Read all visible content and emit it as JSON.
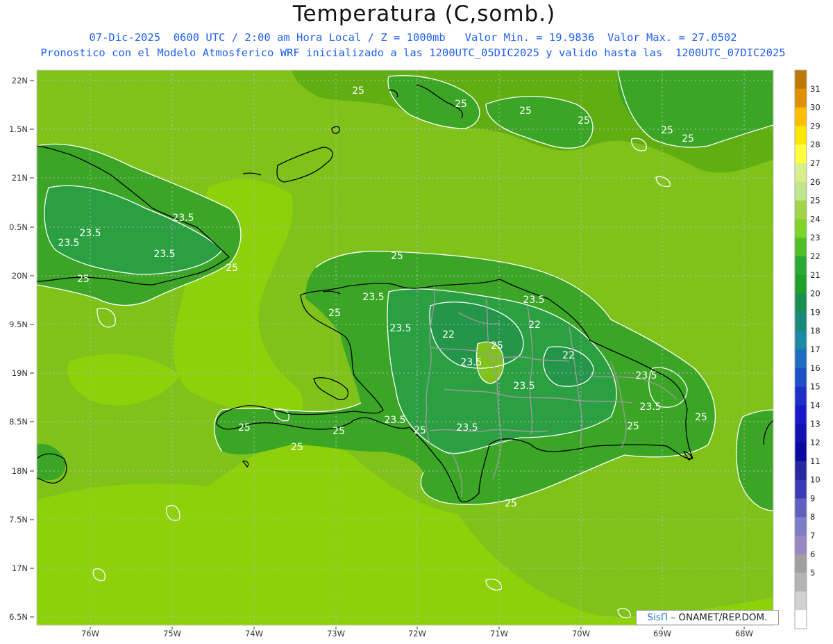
{
  "header": {
    "title": "Temperatura (C,somb.)",
    "line1": "07-Dic-2025  0600 UTC / 2:00 am Hora Local / Z = 1000mb   Valor Min. = 19.9836  Valor Max. = 27.0502",
    "line2": "Pronostico con el Modelo Atmosferico WRF inicializado a las 1200UTC_05DIC2025 y valido hasta las  1200UTC_07DIC2025"
  },
  "credit": {
    "brand": "SisΠ",
    "org": " – ONAMET/REP.DOM."
  },
  "axes": {
    "lat_labels": [
      "22N",
      "1.5N",
      "21N",
      "0.5N",
      "20N",
      "9.5N",
      "19N",
      "8.5N",
      "18N",
      "7.5N",
      "17N",
      "6.5N"
    ],
    "lon_labels": [
      "76W",
      "75W",
      "74W",
      "73W",
      "72W",
      "71W",
      "70W",
      "69W",
      "68W"
    ]
  },
  "colorbar": {
    "labels": [
      "31",
      "30",
      "29",
      "28",
      "27",
      "26",
      "25",
      "24",
      "23",
      "22",
      "21",
      "20",
      "19",
      "18",
      "17",
      "16",
      "15",
      "14",
      "13",
      "12",
      "11",
      "10",
      "9",
      "8",
      "7",
      "6",
      "5"
    ],
    "colors": [
      "#c07800",
      "#e09000",
      "#ffbe00",
      "#ffe800",
      "#ffff40",
      "#d8ef8e",
      "#c2e48a",
      "#a2d44a",
      "#7dd52a",
      "#4ec026",
      "#2aaa34",
      "#1fa028",
      "#199050",
      "#198a7a",
      "#1c8aa2",
      "#1e6dc0",
      "#1e50c8",
      "#1e30c8",
      "#1818c8",
      "#1212b0",
      "#0a0aa0",
      "#2828a0",
      "#3a3ab8",
      "#6060c0",
      "#7e7ec8",
      "#9a86c0",
      "#a0a0a0",
      "#b4b4b4",
      "#d2d2d2",
      "#ffffff"
    ]
  },
  "contour_labels": [
    "25",
    "25",
    "25",
    "25",
    "25",
    "25",
    "23.5",
    "23.5",
    "23.5",
    "25",
    "25",
    "25",
    "23.5",
    "23.5",
    "25",
    "22",
    "22",
    "22",
    "25",
    "23.5",
    "23.5",
    "23.5",
    "23.5",
    "23.5",
    "23.5",
    "25",
    "25",
    "25",
    "25",
    "23.5",
    "25",
    "23.5",
    "25",
    "25"
  ]
}
